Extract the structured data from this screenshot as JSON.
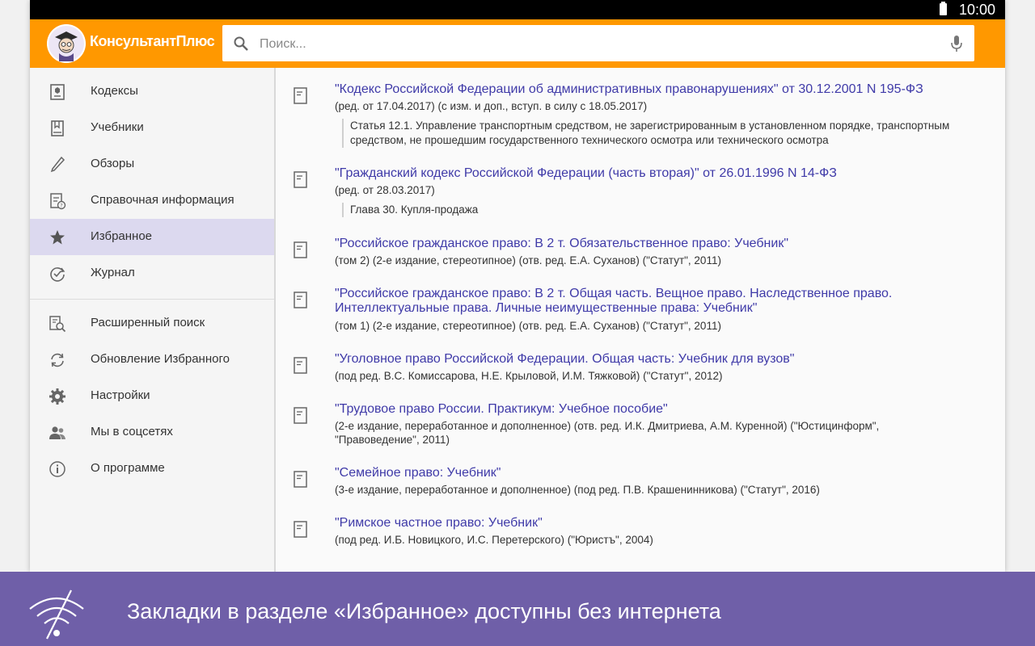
{
  "status_bar": {
    "time": "10:00"
  },
  "app_bar": {
    "brand": "КонсультантПлюс",
    "search_placeholder": "Поиск..."
  },
  "sidebar": {
    "items": [
      {
        "label": "Кодексы",
        "icon": "codex-icon"
      },
      {
        "label": "Учебники",
        "icon": "textbook-icon"
      },
      {
        "label": "Обзоры",
        "icon": "pencil-icon"
      },
      {
        "label": "Справочная информация",
        "icon": "reference-icon"
      },
      {
        "label": "Избранное",
        "icon": "star-icon",
        "active": true
      },
      {
        "label": "Журнал",
        "icon": "history-icon"
      },
      {
        "label": "Расширенный поиск",
        "icon": "advanced-search-icon"
      },
      {
        "label": "Обновление Избранного",
        "icon": "sync-icon"
      },
      {
        "label": "Настройки",
        "icon": "gear-icon"
      },
      {
        "label": "Мы в соцсетях",
        "icon": "people-icon"
      },
      {
        "label": "О программе",
        "icon": "info-icon"
      }
    ]
  },
  "documents": [
    {
      "title": "\"Кодекс Российской Федерации об административных правонарушениях\" от 30.12.2001 N 195-ФЗ",
      "meta": "(ред. от 17.04.2017) (с изм. и доп., вступ. в силу с 18.05.2017)",
      "quote": "Статья 12.1. Управление транспортным средством, не зарегистрированным в установленном порядке, транспортным средством, не прошедшим государственного технического осмотра или технического осмотра"
    },
    {
      "title": "\"Гражданский кодекс Российской Федерации (часть вторая)\" от 26.01.1996 N 14-ФЗ",
      "meta": "(ред. от 28.03.2017)",
      "quote": "Глава 30. Купля-продажа"
    },
    {
      "title": "\"Российское гражданское право: В 2 т. Обязательственное право: Учебник\"",
      "meta": "(том 2) (2-е издание, стереотипное) (отв. ред. Е.А. Суханов) (\"Статут\", 2011)"
    },
    {
      "title": "\"Российское гражданское право: В 2 т. Общая часть. Вещное право. Наследственное право. Интеллектуальные права. Личные неимущественные права: Учебник\"",
      "meta": "(том 1) (2-е издание, стереотипное) (отв. ред. Е.А. Суханов) (\"Статут\", 2011)"
    },
    {
      "title": "\"Уголовное право Российской Федерации. Общая часть: Учебник для вузов\"",
      "meta": "(под ред. В.С. Комиссарова, Н.Е. Крыловой, И.М. Тяжковой) (\"Статут\", 2012)"
    },
    {
      "title": "\"Трудовое право России. Практикум: Учебное пособие\"",
      "meta": "(2-е издание, переработанное и дополненное) (отв. ред. И.К. Дмитриева, А.М. Куренной) (\"Юстицинформ\", \"Правоведение\", 2011)"
    },
    {
      "title": "\"Семейное право: Учебник\"",
      "meta": "(3-е издание, переработанное и дополненное) (под ред. П.В. Крашенинникова) (\"Статут\", 2016)"
    },
    {
      "title": "\"Римское частное право: Учебник\"",
      "meta": "(под ред. И.Б. Новицкого, И.С. Перетерского) (\"Юристъ\", 2004)"
    }
  ],
  "banner": {
    "text": "Закладки в разделе «Избранное» доступны без интернета"
  },
  "colors": {
    "accent": "#ff9800",
    "banner": "#6f5fa8",
    "link": "#3f3aa8",
    "active": "#dcd9ef"
  }
}
